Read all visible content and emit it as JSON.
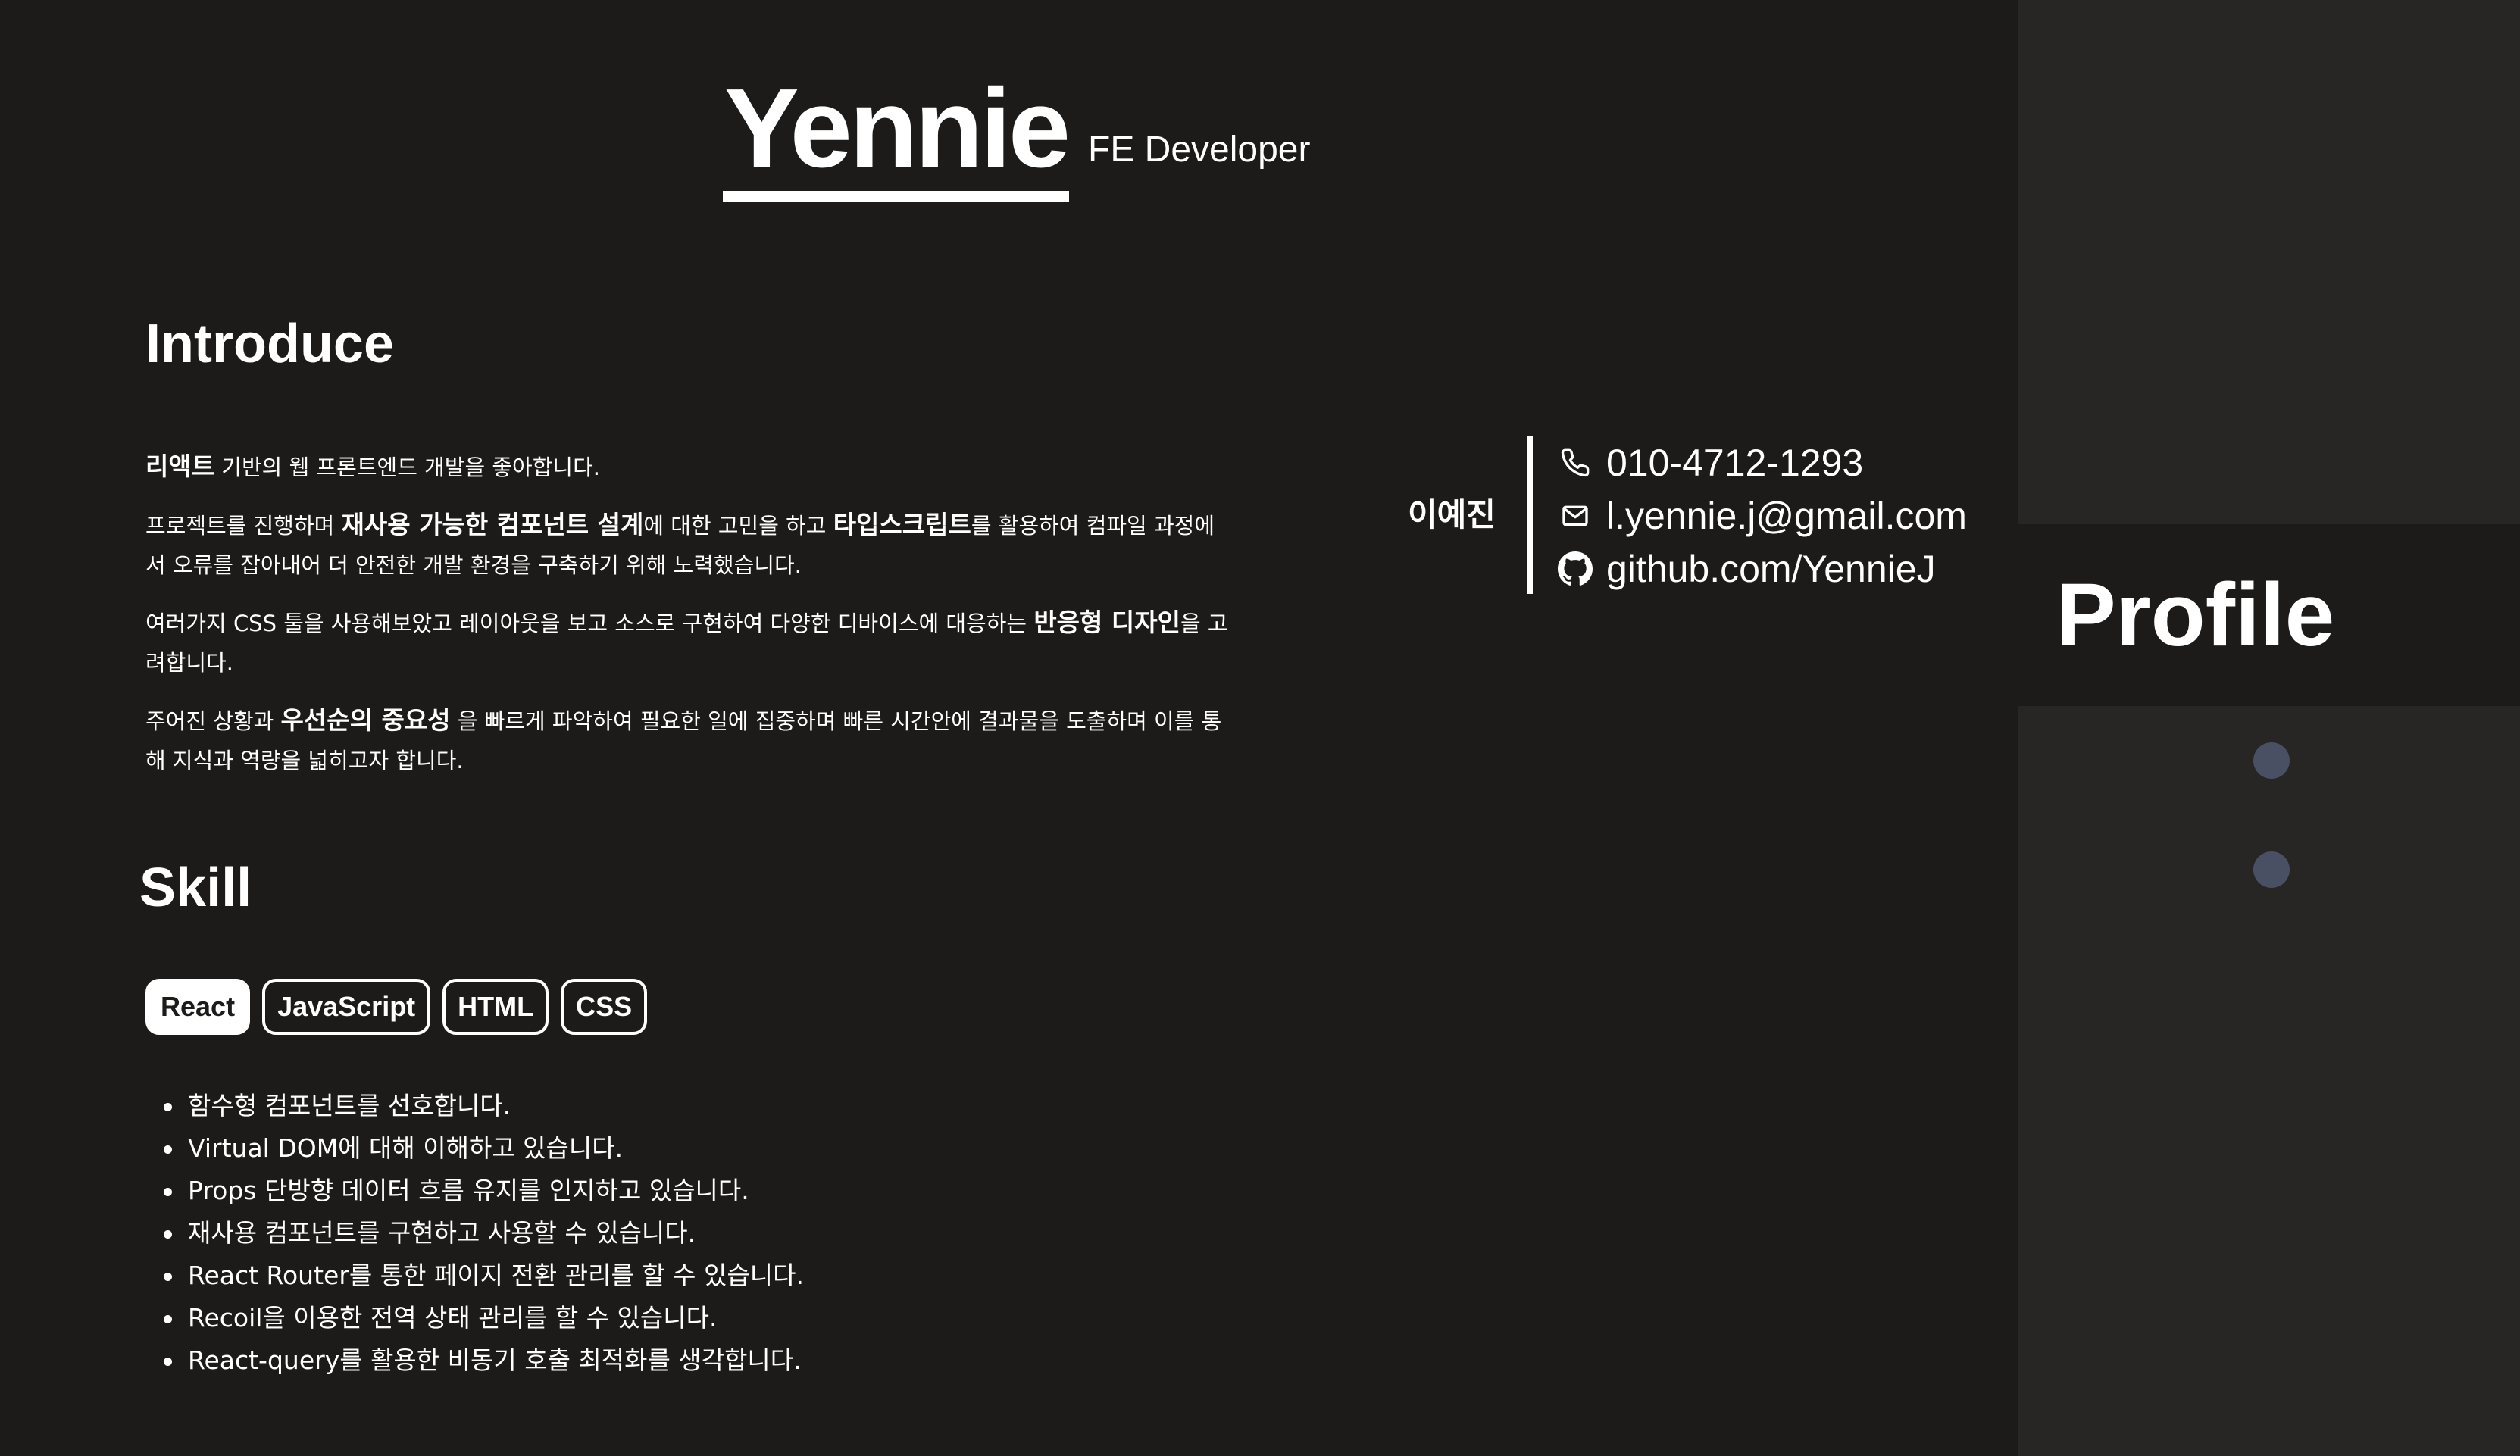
{
  "header": {
    "name": "Yennie",
    "role": "FE Developer"
  },
  "intro": {
    "title": "Introduce",
    "paragraphs": [
      [
        {
          "t": "리액트",
          "b": true
        },
        {
          "t": " 기반의 웹 프론트엔드 개발을 좋아합니다.",
          "b": false
        }
      ],
      [
        {
          "t": "프로젝트를 진행하며 ",
          "b": false
        },
        {
          "t": "재사용 가능한 컴포넌트 설계",
          "b": true
        },
        {
          "t": "에 대한 고민을 하고 ",
          "b": false
        },
        {
          "t": "타입스크립트",
          "b": true
        },
        {
          "t": "를 활용하여 컴파일 과정에서 오류를 잡아내어 더 안전한 개발 환경을 구축하기 위해 노력했습니다.",
          "b": false
        }
      ],
      [
        {
          "t": "여러가지 CSS 툴을 사용해보았고 레이아웃을 보고 소스로 구현하여 다양한 디바이스에 대응하는 ",
          "b": false
        },
        {
          "t": "반응형 디자인",
          "b": true
        },
        {
          "t": "을 고려합니다.",
          "b": false
        }
      ],
      [
        {
          "t": "주어진 상황과 ",
          "b": false
        },
        {
          "t": "우선순의 중요성",
          "b": true
        },
        {
          "t": " 을 빠르게 파악하여 필요한 일에 집중하며 빠른 시간안에 결과물을 도출하며 이를 통해 지식과 역량을 넓히고자 합니다.",
          "b": false
        }
      ]
    ]
  },
  "skill": {
    "title": "Skill",
    "tags": [
      {
        "label": "React",
        "active": true
      },
      {
        "label": "JavaScript",
        "active": false
      },
      {
        "label": "HTML",
        "active": false
      },
      {
        "label": "CSS",
        "active": false
      }
    ],
    "items": [
      "함수형 컴포넌트를 선호합니다.",
      "Virtual DOM에 대해 이해하고 있습니다.",
      "Props 단방향 데이터 흐름 유지를 인지하고 있습니다.",
      "재사용 컴포넌트를 구현하고 사용할 수 있습니다.",
      "React Router를 통한 페이지 전환 관리를 할 수 있습니다.",
      "Recoil을 이용한 전역 상태 관리를 할 수 있습니다.",
      "React-query를 활용한 비동기 호출 최적화를 생각합니다."
    ]
  },
  "contact": {
    "korean_name": "이예진",
    "phone": "010-4712-1293",
    "email": "l.yennie.j@gmail.com",
    "github": "github.com/YennieJ",
    "icons": [
      "phone-icon",
      "mail-icon",
      "github-icon"
    ]
  },
  "sidebar": {
    "title": "Profile",
    "nav_dot_color": "#4a5064"
  },
  "colors": {
    "background": "#1c1b1a",
    "sidebar": "#282625",
    "text": "#ffffff"
  }
}
